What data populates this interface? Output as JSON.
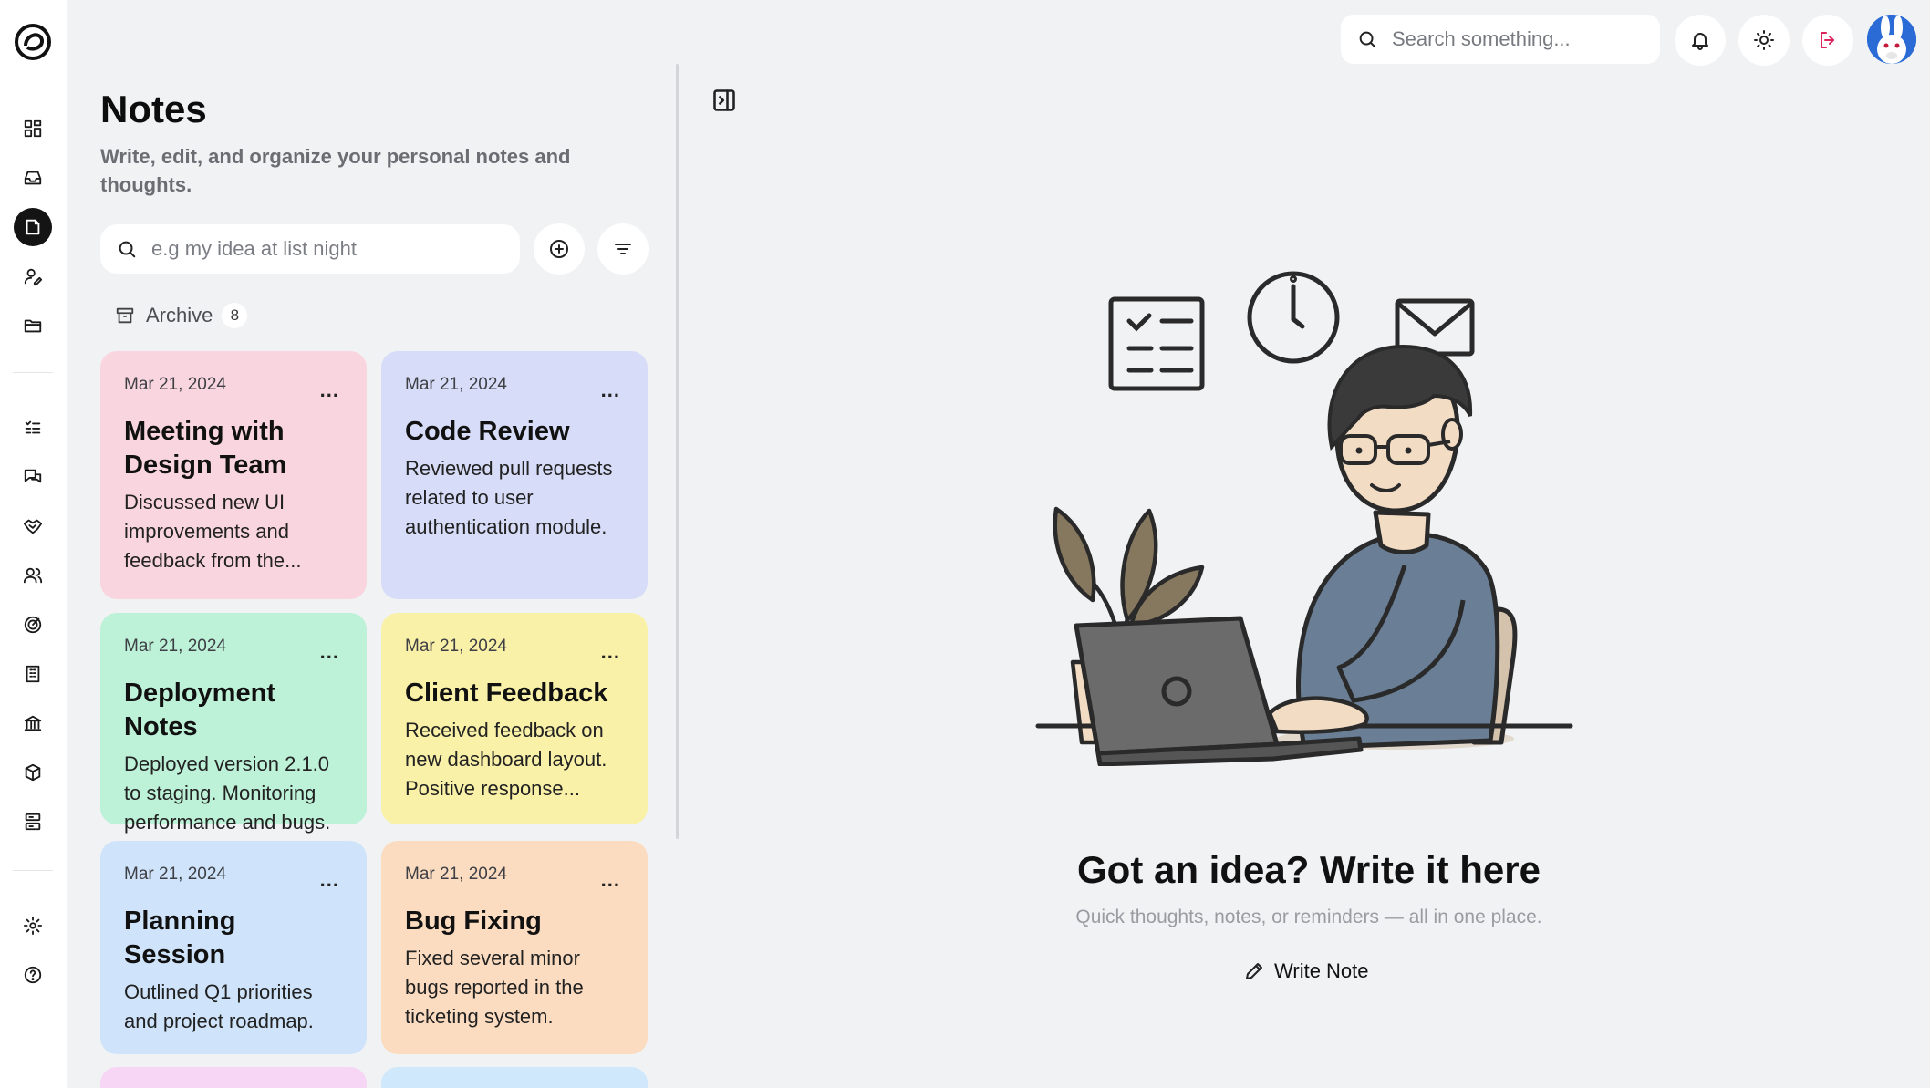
{
  "topbar": {
    "search_placeholder": "Search something..."
  },
  "notes": {
    "title": "Notes",
    "subtitle": "Write, edit, and organize your personal notes and thoughts.",
    "search_placeholder": "e.g my idea at list night",
    "archive_label": "Archive",
    "archive_count": "8",
    "cards": [
      {
        "date": "Mar 21, 2024",
        "title": "Meeting with Design Team",
        "body": "Discussed new UI improvements and feedback from the...",
        "color": "#f9d6df"
      },
      {
        "date": "Mar 21, 2024",
        "title": "Code Review",
        "body": "Reviewed pull requests related to user authentication module.",
        "color": "#d7dcf8"
      },
      {
        "date": "Mar 21, 2024",
        "title": "Deployment Notes",
        "body": "Deployed version 2.1.0 to staging. Monitoring performance and bugs.",
        "color": "#bdf1d8"
      },
      {
        "date": "Mar 21, 2024",
        "title": "Client Feedback",
        "body": "Received feedback on new dashboard layout. Positive response...",
        "color": "#faf1a8"
      },
      {
        "date": "Mar 21, 2024",
        "title": "Planning Session",
        "body": "Outlined Q1 priorities and project roadmap.",
        "color": "#cfe4fb"
      },
      {
        "date": "Mar 21, 2024",
        "title": "Bug Fixing",
        "body": "Fixed several minor bugs reported in the ticketing system.",
        "color": "#fbdcc0"
      },
      {
        "date": "",
        "title": "",
        "body": "",
        "color": "#f6d6f4"
      },
      {
        "date": "",
        "title": "",
        "body": "",
        "color": "#cfe8fb"
      }
    ],
    "more_label": "..."
  },
  "empty_state": {
    "title": "Got an idea? Write it here",
    "subtitle": "Quick thoughts, notes, or reminders — all in one place.",
    "button_label": "Write Note"
  },
  "icons": {
    "sidebar": [
      "dashboard-icon",
      "inbox-icon",
      "notes-icon",
      "user-edit-icon",
      "folder-icon",
      "tasks-icon",
      "chat-icon",
      "handshake-icon",
      "users-icon",
      "analytics-icon",
      "building-icon",
      "bank-icon",
      "package-icon",
      "server-icon",
      "settings-icon",
      "help-icon"
    ]
  },
  "colors": {
    "background": "#f1f2f4",
    "active_nav": "#141414",
    "logout_accent": "#e0245e"
  }
}
